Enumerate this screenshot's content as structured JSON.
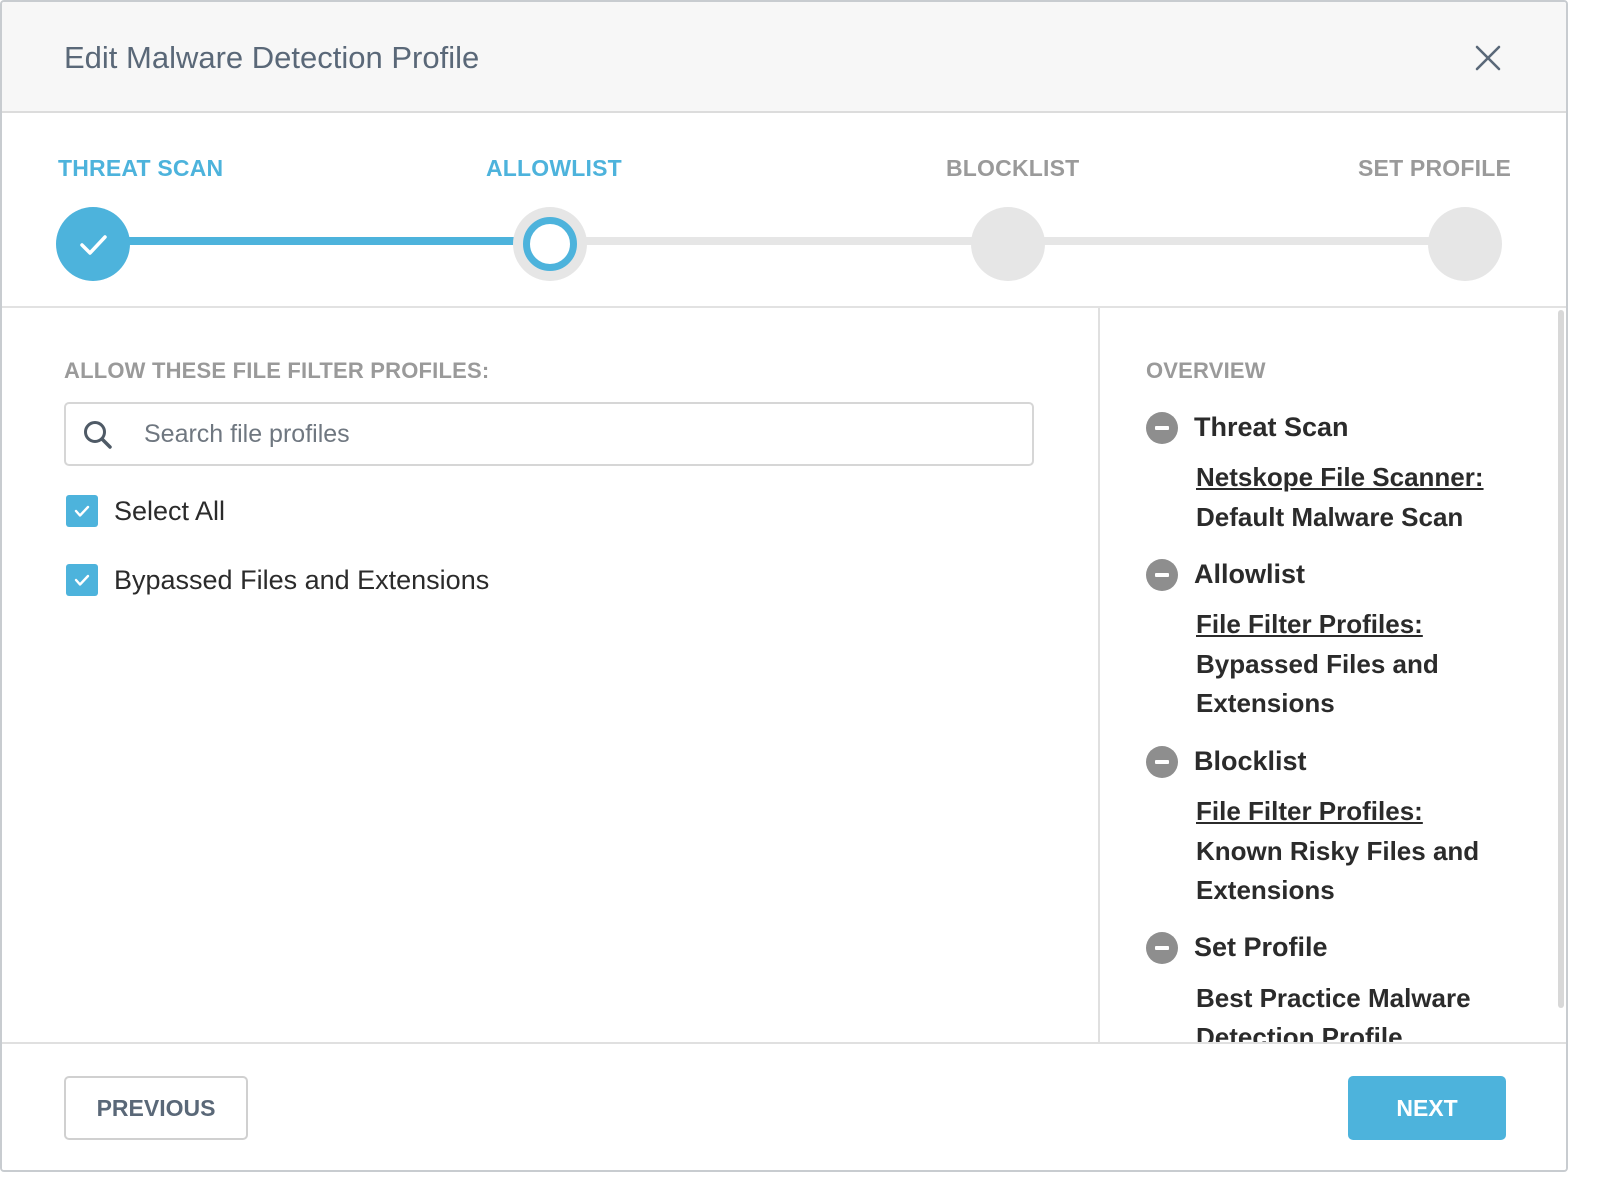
{
  "modal": {
    "title": "Edit Malware Detection Profile"
  },
  "steps": [
    {
      "label": "THREAT SCAN",
      "state": "done"
    },
    {
      "label": "ALLOWLIST",
      "state": "current"
    },
    {
      "label": "BLOCKLIST",
      "state": "upcoming"
    },
    {
      "label": "SET PROFILE",
      "state": "upcoming"
    }
  ],
  "left": {
    "section_title": "ALLOW THESE FILE FILTER PROFILES:",
    "search": {
      "placeholder": "Search file profiles",
      "value": ""
    },
    "options": [
      {
        "label": "Select All",
        "checked": true
      },
      {
        "label": "Bypassed Files and Extensions",
        "checked": true
      }
    ]
  },
  "overview": {
    "title": "OVERVIEW",
    "sections": [
      {
        "heading": "Threat Scan",
        "link": "Netskope File Scanner:",
        "text": "Default Malware Scan"
      },
      {
        "heading": "Allowlist",
        "link": "File Filter Profiles:",
        "text": "Bypassed Files and Extensions"
      },
      {
        "heading": "Blocklist",
        "link": "File Filter Profiles:",
        "text": "Known Risky Files and Extensions"
      },
      {
        "heading": "Set Profile",
        "link": "",
        "text": "Best Practice Malware Detection Profile"
      }
    ]
  },
  "footer": {
    "previous_label": "PREVIOUS",
    "next_label": "NEXT"
  },
  "colors": {
    "accent": "#4db3dc",
    "inactive": "#e6e6e6",
    "muted_text": "#9a9a9a"
  },
  "icons": [
    "close-icon",
    "check-icon",
    "search-icon",
    "minus-circle-icon"
  ]
}
